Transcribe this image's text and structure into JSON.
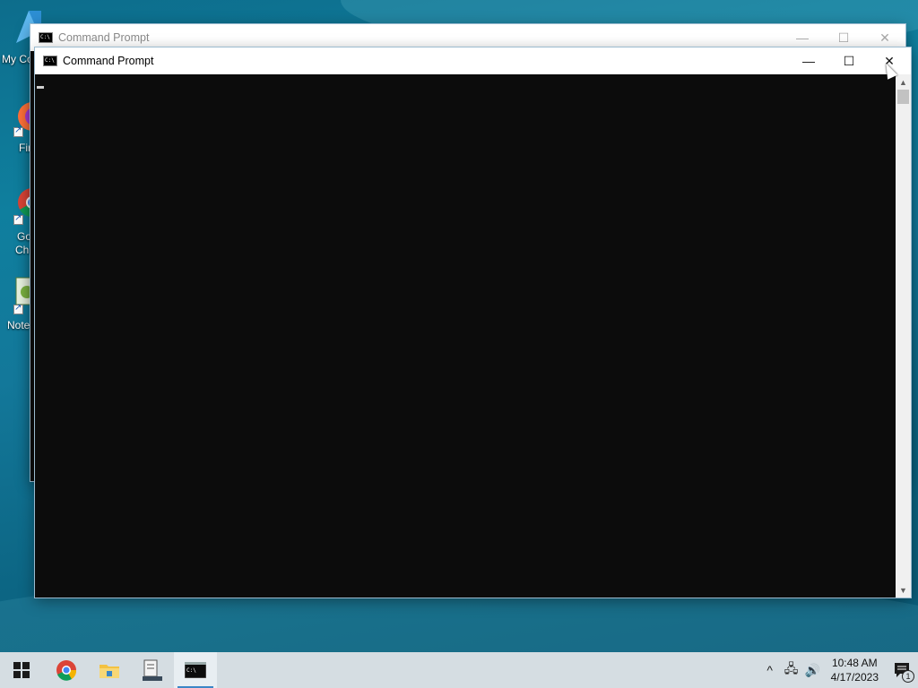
{
  "desktop": {
    "icons": [
      {
        "label": "My Co",
        "icon": "this-pc-icon"
      },
      {
        "label": "Fir",
        "icon": "firefox-icon"
      },
      {
        "label": "Go",
        "label2": "Chr",
        "icon": "chrome-icon"
      },
      {
        "label": "Note",
        "icon": "notepad-icon"
      }
    ]
  },
  "back_window": {
    "title": "Command Prompt",
    "controls": {
      "minimize": "—",
      "maximize": "☐",
      "close": "✕"
    }
  },
  "front_window": {
    "title": "Command Prompt",
    "controls": {
      "minimize": "—",
      "maximize": "☐",
      "close": "✕"
    },
    "console_text": "",
    "scroll_up": "▲",
    "scroll_down": "▼"
  },
  "taskbar": {
    "items": [
      {
        "name": "start-button",
        "icon": "windows-logo-icon"
      },
      {
        "name": "chrome",
        "icon": "chrome-icon"
      },
      {
        "name": "file-explorer",
        "icon": "folder-icon"
      },
      {
        "name": "app",
        "icon": "app-icon"
      },
      {
        "name": "command-prompt",
        "icon": "cmd-icon",
        "active": true
      }
    ],
    "tray": {
      "chevron": "^",
      "network": "🖧",
      "volume": "🔊",
      "time": "10:48 AM",
      "date": "4/17/2023",
      "notifications_count": "1"
    }
  },
  "colors": {
    "console_bg": "#0c0c0c",
    "taskbar_bg": "#d5dde2",
    "accent": "#3b86c6"
  }
}
